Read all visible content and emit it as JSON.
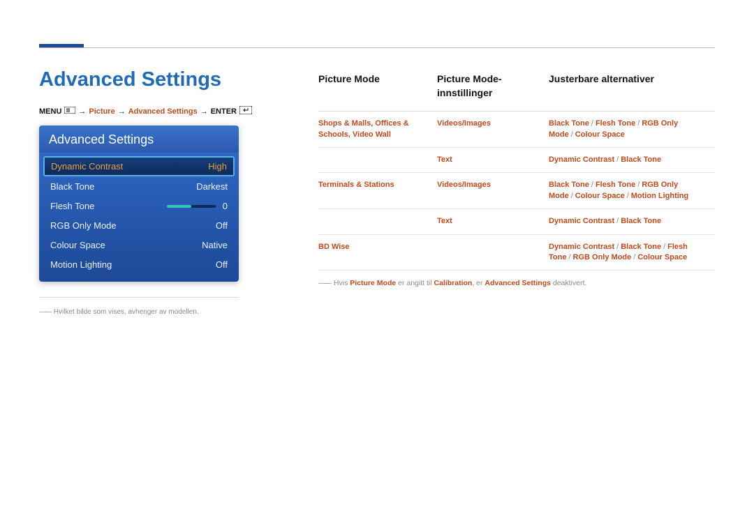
{
  "page": {
    "title": "Advanced Settings"
  },
  "breadcrumb": {
    "menu_label": "MENU",
    "arrow": "→",
    "picture": "Picture",
    "advanced": "Advanced Settings",
    "enter_label": "ENTER"
  },
  "osd": {
    "header": "Advanced Settings",
    "items": [
      {
        "label": "Dynamic Contrast",
        "value": "High",
        "selected": true,
        "slider": false
      },
      {
        "label": "Black Tone",
        "value": "Darkest",
        "selected": false,
        "slider": false
      },
      {
        "label": "Flesh Tone",
        "value": "0",
        "selected": false,
        "slider": true
      },
      {
        "label": "RGB Only Mode",
        "value": "Off",
        "selected": false,
        "slider": false
      },
      {
        "label": "Colour Space",
        "value": "Native",
        "selected": false,
        "slider": false
      },
      {
        "label": "Motion Lighting",
        "value": "Off",
        "selected": false,
        "slider": false
      }
    ]
  },
  "footnote": {
    "dash": "――",
    "text": "Hvilket bilde som vises, avhenger av modellen."
  },
  "table": {
    "headers": [
      "Picture Mode",
      "Picture Mode-innstillinger",
      "Justerbare alternativer"
    ],
    "rows": [
      {
        "mode": "Shops & Malls, Offices & Schools, Video Wall",
        "setting": "Videos/Images",
        "options": [
          "Black Tone",
          "Flesh Tone",
          "RGB Only Mode",
          "Colour Space"
        ]
      },
      {
        "mode": "",
        "setting": "Text",
        "options": [
          "Dynamic Contrast",
          "Black Tone"
        ]
      },
      {
        "mode": "Terminals & Stations",
        "setting": "Videos/Images",
        "options": [
          "Black Tone",
          "Flesh Tone",
          "RGB Only Mode",
          "Colour Space",
          "Motion Lighting"
        ]
      },
      {
        "mode": "",
        "setting": "Text",
        "options": [
          "Dynamic Contrast",
          "Black Tone"
        ]
      },
      {
        "mode": "BD Wise",
        "setting": "",
        "options": [
          "Dynamic Contrast",
          "Black Tone",
          "Flesh Tone",
          "RGB Only Mode",
          "Colour Space"
        ]
      }
    ]
  },
  "note": {
    "dash": "――",
    "t1": "Hvis ",
    "picture_mode": "Picture Mode",
    "t2": " er angitt til ",
    "calibration": "Calibration",
    "t3": ", er ",
    "advanced": "Advanced Settings",
    "t4": " deaktivert."
  }
}
